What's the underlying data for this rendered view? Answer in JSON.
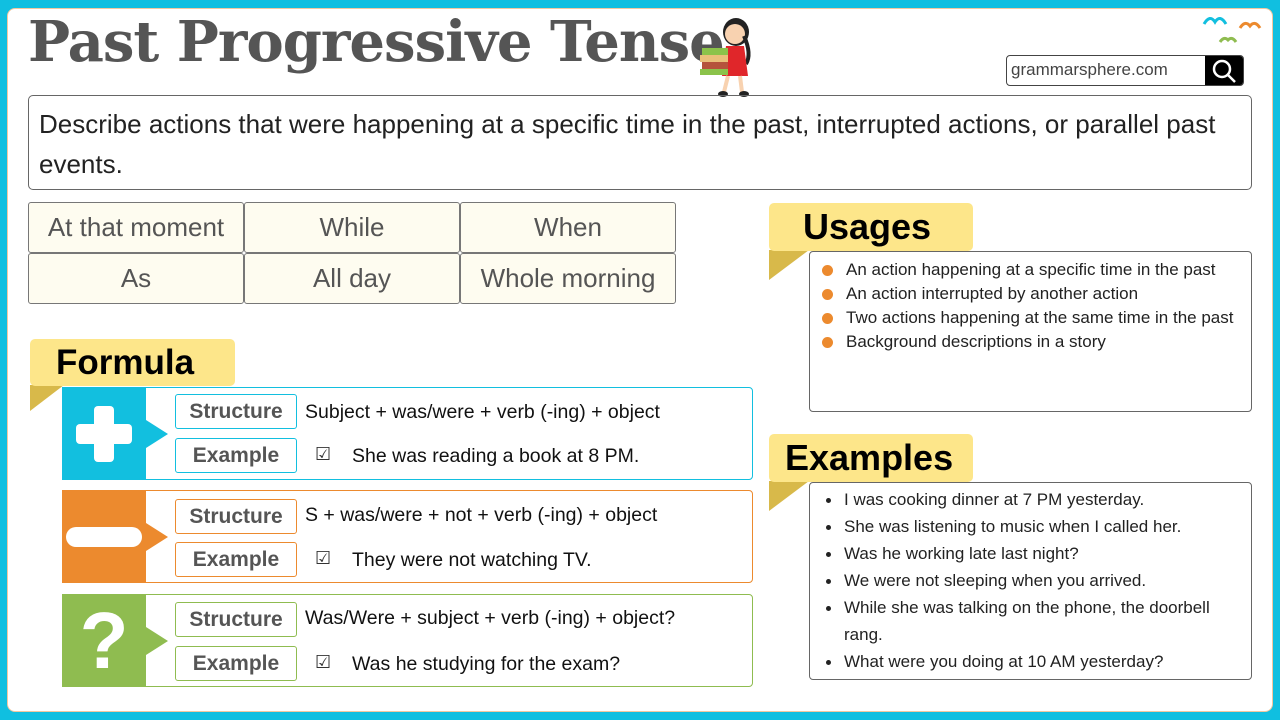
{
  "header": {
    "title": "Past Progressive Tense",
    "site": "grammarsphere.com",
    "search_icon": "search-icon"
  },
  "description": "Describe actions that were happening at a specific time in the past, interrupted actions, or parallel past events.",
  "keywords": [
    "At that moment",
    "While",
    "When",
    "As",
    "All day",
    "Whole morning"
  ],
  "formula": {
    "heading": "Formula",
    "rows": [
      {
        "type": "affirmative",
        "icon": "plus-icon",
        "color": "#12bfdf",
        "structure_label": "Structure",
        "structure": "Subject + was/were + verb (-ing) + object",
        "example_label": "Example",
        "example": "She was reading a book at 8 PM."
      },
      {
        "type": "negative",
        "icon": "minus-icon",
        "color": "#ec8a2e",
        "structure_label": "Structure",
        "structure": "S + was/were + not + verb (-ing) + object",
        "example_label": "Example",
        "example": "They were not watching TV."
      },
      {
        "type": "interrogative",
        "icon": "question-icon",
        "color": "#8fbc50",
        "structure_label": "Structure",
        "structure": "Was/Were + subject + verb (-ing) + object?",
        "example_label": "Example",
        "example": "Was he studying for the exam?"
      }
    ]
  },
  "usages": {
    "heading": "Usages",
    "items": [
      "An action happening at a specific time in the past",
      "An action interrupted by another action",
      "Two actions happening at the same time in the past",
      "Background descriptions in a story"
    ]
  },
  "examples": {
    "heading": "Examples",
    "items": [
      "I was cooking dinner at 7 PM yesterday.",
      "She was listening to music when I called her.",
      "Was he working late last night?",
      "We were not sleeping when you arrived.",
      "While she was talking on the phone, the doorbell rang.",
      "What were you doing at 10 AM yesterday?"
    ]
  },
  "colors": {
    "frame": "#10bfe0",
    "tag": "#fde68a",
    "tag_fold": "#d8b94a",
    "bullet": "#ec8a2e"
  }
}
